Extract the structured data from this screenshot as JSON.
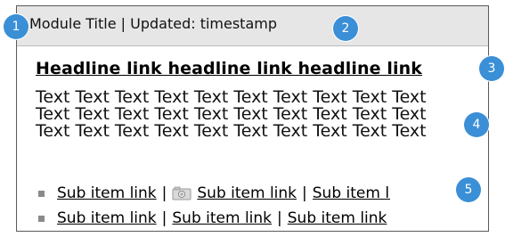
{
  "header": {
    "text": "Module Title | Updated: timestamp"
  },
  "headline": {
    "label": "Headline link headline link headline link"
  },
  "body": {
    "text": "Text Text Text Text Text Text Text Text Text Text Text Text Text Text Text Text Text Text Text Text Text Text Text Text Text Text Text Text Text Text"
  },
  "sub_items": {
    "row1": [
      "Sub item link",
      "Sub item link",
      "Sub item li"
    ],
    "row2": [
      "Sub item link",
      "Sub item link",
      "Sub item link"
    ],
    "separator": "|"
  },
  "markers": [
    "1",
    "2",
    "3",
    "4",
    "5"
  ],
  "colors": {
    "marker": "#3a8fd6",
    "header_bg": "#e6e6e6",
    "border": "#5a5a5a",
    "bullet": "#8a8a8a"
  }
}
